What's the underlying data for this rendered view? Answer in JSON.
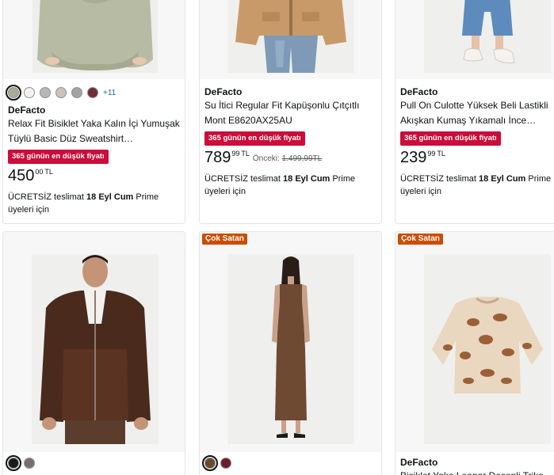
{
  "products": [
    {
      "brand": "DeFacto",
      "title": "Relax Fit Bisiklet Yaka Kalın İçi Yumuşak Tüylü Basic Düz Sweatshirt…",
      "deal_badge": "365 günün en düşük fiyatı",
      "price_whole": "450",
      "price_fraction": "00",
      "currency": "TL",
      "delivery_prefix": "ÜCRETSİZ teslimat",
      "delivery_date": "18 Eyl Cum",
      "delivery_suffix": "Prime üyeleri için",
      "more_colors": "+11",
      "swatch_colors": [
        "#a9ab93",
        "#f4f1ee",
        "#b8b8b8",
        "#c9c3bc",
        "#a3a3a3",
        "#6e2d3a"
      ]
    },
    {
      "brand": "DeFacto",
      "title": "Su İtici Regular Fit Kapüşonlu Çıtçıtlı Mont E8620AX25AU",
      "deal_badge": "365 günün en düşük fiyatı",
      "price_whole": "789",
      "price_fraction": "99",
      "currency": "TL",
      "previous_label": "Önceki:",
      "previous_price": "1.499,99TL",
      "delivery_prefix": "ÜCRETSİZ teslimat",
      "delivery_date": "18 Eyl Cum",
      "delivery_suffix": "Prime üyeleri için"
    },
    {
      "brand": "DeFacto",
      "title": "Pull On Culotte Yüksek Beli Lastikli Akışkan Kumaş Yıkamalı İnce Jean…",
      "deal_badge": "365 günün en düşük fiyatı",
      "price_whole": "239",
      "price_fraction": "99",
      "currency": "TL",
      "delivery_prefix": "ÜCRETSİZ teslimat",
      "delivery_date": "18 Eyl Cum",
      "delivery_suffix": "Prime üyeleri için"
    },
    {
      "swatch_colors": [
        "#1a1a1a",
        "#7a6f6d"
      ]
    },
    {
      "badge": "Çok Satan",
      "swatch_colors": [
        "#6b4a2a",
        "#6e1f2a"
      ]
    },
    {
      "badge": "Çok Satan",
      "brand": "DeFacto",
      "title": "Bisiklet Yaka Leopar Desenli Triko Kazak"
    }
  ]
}
